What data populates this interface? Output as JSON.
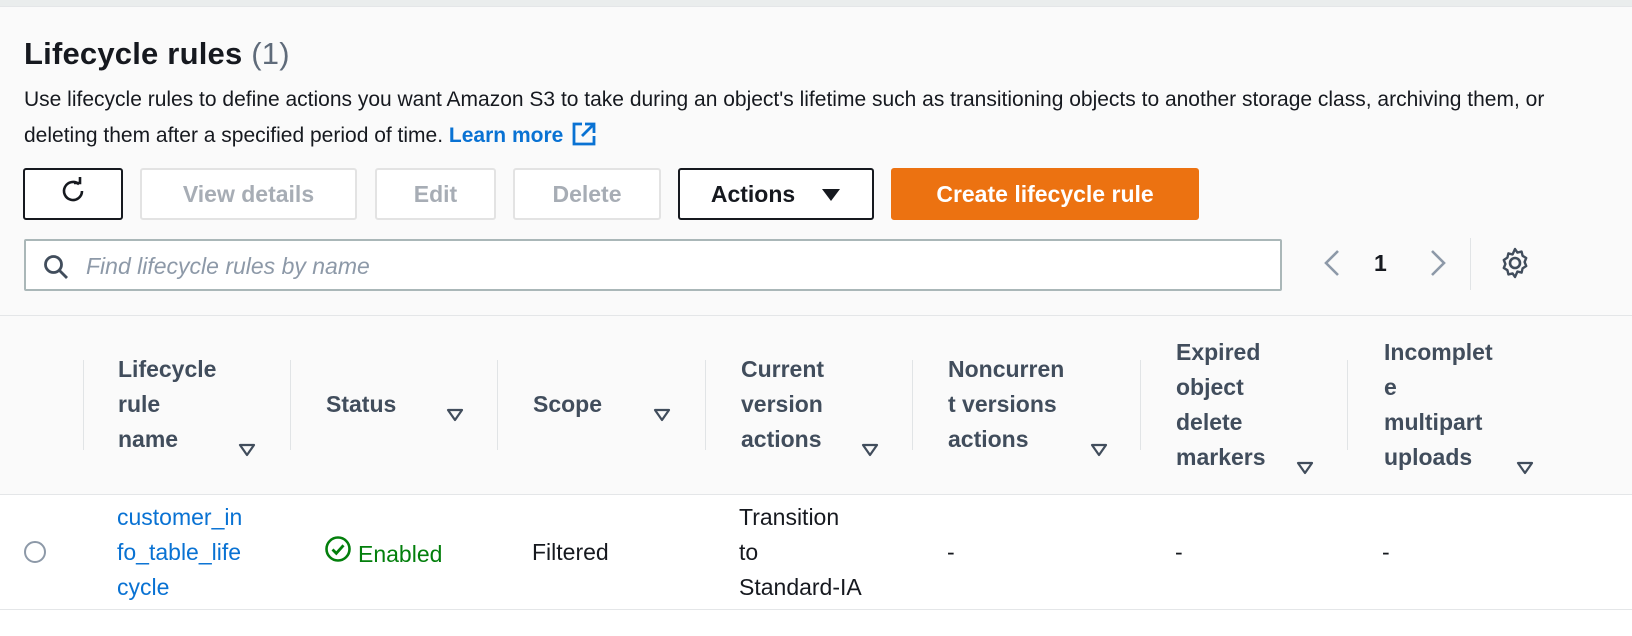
{
  "header": {
    "title": "Lifecycle rules",
    "count": "(1)",
    "description": "Use lifecycle rules to define actions you want Amazon S3 to take during an object's lifetime such as transitioning objects to another storage class, archiving them, or deleting them after a specified period of time.",
    "learn_more": "Learn more"
  },
  "toolbar": {
    "view_details": "View details",
    "edit": "Edit",
    "delete": "Delete",
    "actions": "Actions",
    "create": "Create lifecycle rule"
  },
  "search": {
    "placeholder": "Find lifecycle rules by name",
    "value": ""
  },
  "pagination": {
    "current_page": "1"
  },
  "table": {
    "columns": [
      {
        "l1": "Lifecycle",
        "l2": "rule",
        "l3": "name",
        "l4": ""
      },
      {
        "l1": "Status",
        "l2": "",
        "l3": "",
        "l4": ""
      },
      {
        "l1": "Scope",
        "l2": "",
        "l3": "",
        "l4": ""
      },
      {
        "l1": "Current",
        "l2": "version",
        "l3": "actions",
        "l4": ""
      },
      {
        "l1": "Noncurren",
        "l2": "t versions",
        "l3": "actions",
        "l4": ""
      },
      {
        "l1": "Expired",
        "l2": "object",
        "l3": "delete",
        "l4": "markers"
      },
      {
        "l1": "Incomplet",
        "l2": "e",
        "l3": "multipart",
        "l4": "uploads"
      }
    ],
    "rows": [
      {
        "name_l1": "customer_in",
        "name_l2": "fo_table_life",
        "name_l3": "cycle",
        "status": "Enabled",
        "scope": "Filtered",
        "current_l1": "Transition",
        "current_l2": "to",
        "current_l3": "Standard-IA",
        "noncurrent": "-",
        "expired": "-",
        "incomplete": "-"
      }
    ]
  },
  "icons": {
    "refresh": "refresh-icon",
    "external": "external-link-icon",
    "search": "search-icon",
    "caret": "caret-down-icon",
    "sort": "sort-down-icon",
    "prev": "chevron-left-icon",
    "next": "chevron-right-icon",
    "settings": "gear-icon",
    "status_ok": "check-circle-icon"
  },
  "colors": {
    "primary": "#ec7211",
    "link": "#0972d3",
    "success": "#037f0c"
  }
}
